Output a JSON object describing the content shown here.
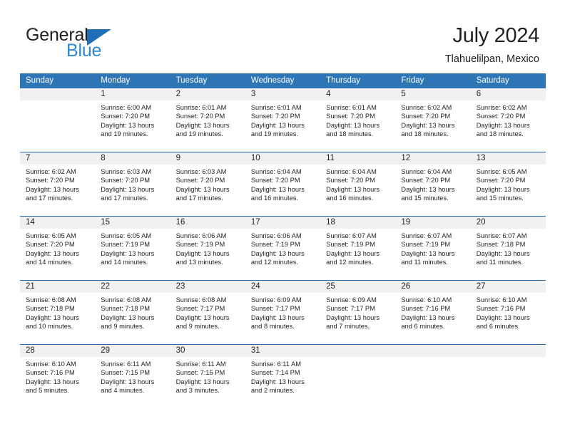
{
  "logo": {
    "word_top": "General",
    "word_bottom": "Blue",
    "triangle_color": "#1f6fb8",
    "blue_color": "#2e87d0"
  },
  "header": {
    "title": "July 2024",
    "subtitle": "Tlahuelilpan, Mexico"
  },
  "theme": {
    "header_bg": "#2e75b6",
    "row_divider": "#2268ab",
    "daynum_band": "#f1f1f1",
    "text": "#231f20"
  },
  "weekdays": [
    "Sunday",
    "Monday",
    "Tuesday",
    "Wednesday",
    "Thursday",
    "Friday",
    "Saturday"
  ],
  "labels": {
    "sunrise_prefix": "Sunrise: ",
    "sunset_prefix": "Sunset: ",
    "daylight_prefix": "Daylight: "
  },
  "weeks": [
    [
      {
        "day": "",
        "empty": true
      },
      {
        "day": "1",
        "sunrise": "Sunrise: 6:00 AM",
        "sunset": "Sunset: 7:20 PM",
        "daylight": "Daylight: 13 hours and 19 minutes."
      },
      {
        "day": "2",
        "sunrise": "Sunrise: 6:01 AM",
        "sunset": "Sunset: 7:20 PM",
        "daylight": "Daylight: 13 hours and 19 minutes."
      },
      {
        "day": "3",
        "sunrise": "Sunrise: 6:01 AM",
        "sunset": "Sunset: 7:20 PM",
        "daylight": "Daylight: 13 hours and 19 minutes."
      },
      {
        "day": "4",
        "sunrise": "Sunrise: 6:01 AM",
        "sunset": "Sunset: 7:20 PM",
        "daylight": "Daylight: 13 hours and 18 minutes."
      },
      {
        "day": "5",
        "sunrise": "Sunrise: 6:02 AM",
        "sunset": "Sunset: 7:20 PM",
        "daylight": "Daylight: 13 hours and 18 minutes."
      },
      {
        "day": "6",
        "sunrise": "Sunrise: 6:02 AM",
        "sunset": "Sunset: 7:20 PM",
        "daylight": "Daylight: 13 hours and 18 minutes."
      }
    ],
    [
      {
        "day": "7",
        "sunrise": "Sunrise: 6:02 AM",
        "sunset": "Sunset: 7:20 PM",
        "daylight": "Daylight: 13 hours and 17 minutes."
      },
      {
        "day": "8",
        "sunrise": "Sunrise: 6:03 AM",
        "sunset": "Sunset: 7:20 PM",
        "daylight": "Daylight: 13 hours and 17 minutes."
      },
      {
        "day": "9",
        "sunrise": "Sunrise: 6:03 AM",
        "sunset": "Sunset: 7:20 PM",
        "daylight": "Daylight: 13 hours and 17 minutes."
      },
      {
        "day": "10",
        "sunrise": "Sunrise: 6:04 AM",
        "sunset": "Sunset: 7:20 PM",
        "daylight": "Daylight: 13 hours and 16 minutes."
      },
      {
        "day": "11",
        "sunrise": "Sunrise: 6:04 AM",
        "sunset": "Sunset: 7:20 PM",
        "daylight": "Daylight: 13 hours and 16 minutes."
      },
      {
        "day": "12",
        "sunrise": "Sunrise: 6:04 AM",
        "sunset": "Sunset: 7:20 PM",
        "daylight": "Daylight: 13 hours and 15 minutes."
      },
      {
        "day": "13",
        "sunrise": "Sunrise: 6:05 AM",
        "sunset": "Sunset: 7:20 PM",
        "daylight": "Daylight: 13 hours and 15 minutes."
      }
    ],
    [
      {
        "day": "14",
        "sunrise": "Sunrise: 6:05 AM",
        "sunset": "Sunset: 7:20 PM",
        "daylight": "Daylight: 13 hours and 14 minutes."
      },
      {
        "day": "15",
        "sunrise": "Sunrise: 6:05 AM",
        "sunset": "Sunset: 7:19 PM",
        "daylight": "Daylight: 13 hours and 14 minutes."
      },
      {
        "day": "16",
        "sunrise": "Sunrise: 6:06 AM",
        "sunset": "Sunset: 7:19 PM",
        "daylight": "Daylight: 13 hours and 13 minutes."
      },
      {
        "day": "17",
        "sunrise": "Sunrise: 6:06 AM",
        "sunset": "Sunset: 7:19 PM",
        "daylight": "Daylight: 13 hours and 12 minutes."
      },
      {
        "day": "18",
        "sunrise": "Sunrise: 6:07 AM",
        "sunset": "Sunset: 7:19 PM",
        "daylight": "Daylight: 13 hours and 12 minutes."
      },
      {
        "day": "19",
        "sunrise": "Sunrise: 6:07 AM",
        "sunset": "Sunset: 7:19 PM",
        "daylight": "Daylight: 13 hours and 11 minutes."
      },
      {
        "day": "20",
        "sunrise": "Sunrise: 6:07 AM",
        "sunset": "Sunset: 7:18 PM",
        "daylight": "Daylight: 13 hours and 11 minutes."
      }
    ],
    [
      {
        "day": "21",
        "sunrise": "Sunrise: 6:08 AM",
        "sunset": "Sunset: 7:18 PM",
        "daylight": "Daylight: 13 hours and 10 minutes."
      },
      {
        "day": "22",
        "sunrise": "Sunrise: 6:08 AM",
        "sunset": "Sunset: 7:18 PM",
        "daylight": "Daylight: 13 hours and 9 minutes."
      },
      {
        "day": "23",
        "sunrise": "Sunrise: 6:08 AM",
        "sunset": "Sunset: 7:17 PM",
        "daylight": "Daylight: 13 hours and 9 minutes."
      },
      {
        "day": "24",
        "sunrise": "Sunrise: 6:09 AM",
        "sunset": "Sunset: 7:17 PM",
        "daylight": "Daylight: 13 hours and 8 minutes."
      },
      {
        "day": "25",
        "sunrise": "Sunrise: 6:09 AM",
        "sunset": "Sunset: 7:17 PM",
        "daylight": "Daylight: 13 hours and 7 minutes."
      },
      {
        "day": "26",
        "sunrise": "Sunrise: 6:10 AM",
        "sunset": "Sunset: 7:16 PM",
        "daylight": "Daylight: 13 hours and 6 minutes."
      },
      {
        "day": "27",
        "sunrise": "Sunrise: 6:10 AM",
        "sunset": "Sunset: 7:16 PM",
        "daylight": "Daylight: 13 hours and 6 minutes."
      }
    ],
    [
      {
        "day": "28",
        "sunrise": "Sunrise: 6:10 AM",
        "sunset": "Sunset: 7:16 PM",
        "daylight": "Daylight: 13 hours and 5 minutes."
      },
      {
        "day": "29",
        "sunrise": "Sunrise: 6:11 AM",
        "sunset": "Sunset: 7:15 PM",
        "daylight": "Daylight: 13 hours and 4 minutes."
      },
      {
        "day": "30",
        "sunrise": "Sunrise: 6:11 AM",
        "sunset": "Sunset: 7:15 PM",
        "daylight": "Daylight: 13 hours and 3 minutes."
      },
      {
        "day": "31",
        "sunrise": "Sunrise: 6:11 AM",
        "sunset": "Sunset: 7:14 PM",
        "daylight": "Daylight: 13 hours and 2 minutes."
      },
      {
        "day": "",
        "empty": true
      },
      {
        "day": "",
        "empty": true
      },
      {
        "day": "",
        "empty": true
      }
    ]
  ]
}
